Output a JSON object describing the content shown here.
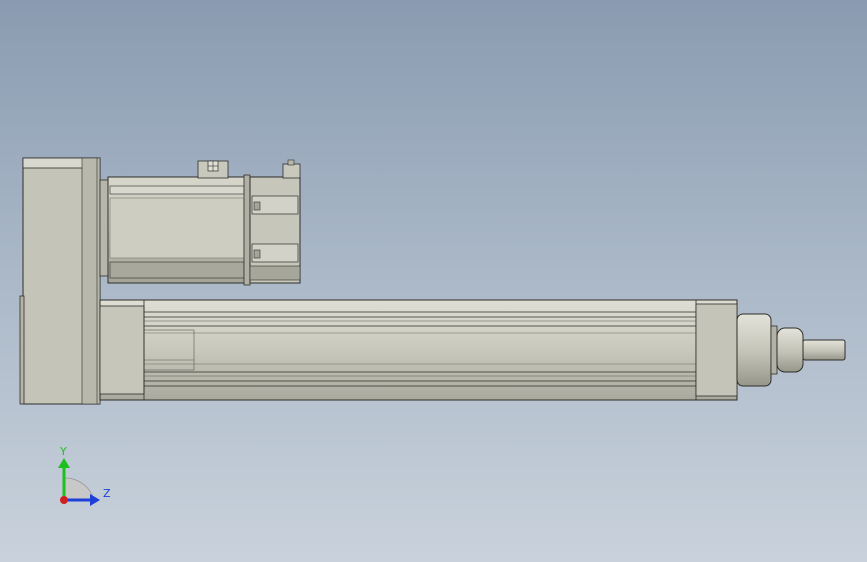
{
  "viewport": {
    "background_top": "#8a9bb1",
    "background_bottom": "#c9d2dc"
  },
  "model": {
    "body_color": "#c9c9bd",
    "shadow_color": "#9c9c90",
    "edge_color": "#2e2e2a",
    "highlight_color": "#e4e4da"
  },
  "triad": {
    "y_label": "Y",
    "z_label": "Z",
    "y_color": "#1fbf1f",
    "z_color": "#1f3fd9",
    "x_color": "#d01f1f",
    "plane_color": "#c8c8c8"
  }
}
